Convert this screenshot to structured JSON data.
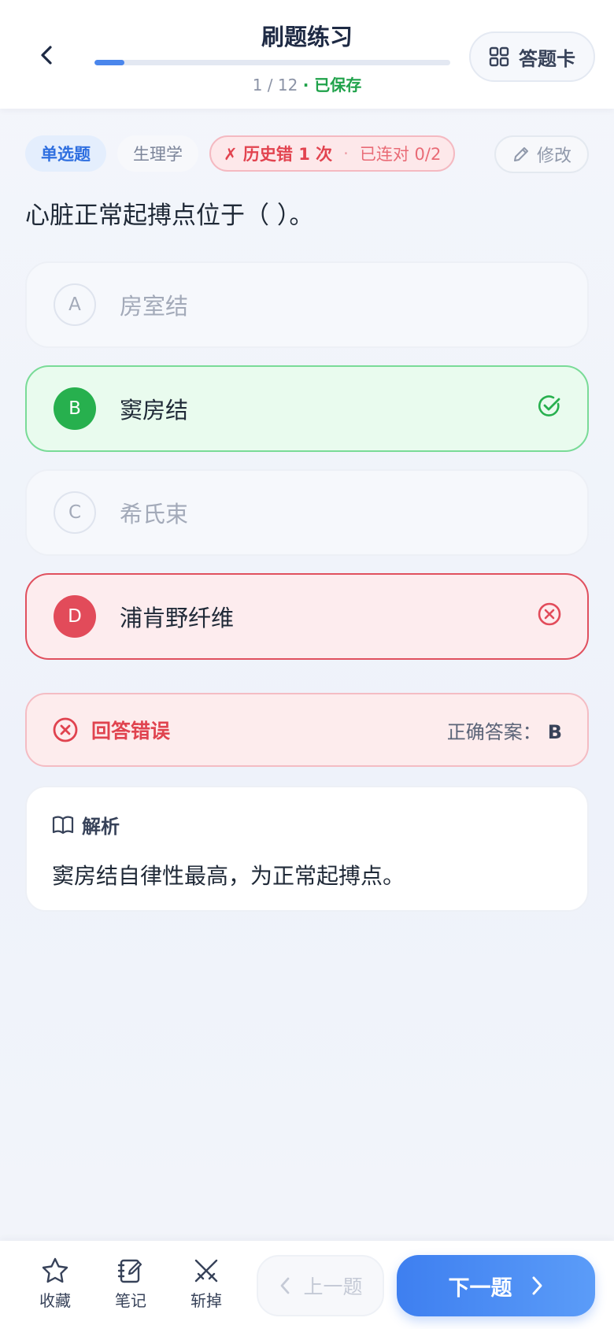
{
  "header": {
    "title": "刷题练习",
    "progress_current": 1,
    "progress_total": 12,
    "progress_text": "1 / 12",
    "saved_text": "· 已保存",
    "answer_card_label": "答题卡",
    "progress_fraction": 0.083
  },
  "tags": {
    "type": "单选题",
    "subject": "生理学",
    "history_error": "✗ 历史错 1 次",
    "history_separator": "·",
    "streak": "已连对 0/2"
  },
  "edit_label": "修改",
  "question": "心脏正常起搏点位于（ ）。",
  "options": [
    {
      "letter": "A",
      "text": "房室结",
      "state": "neutral"
    },
    {
      "letter": "B",
      "text": "窦房结",
      "state": "correct"
    },
    {
      "letter": "C",
      "text": "希氏束",
      "state": "neutral"
    },
    {
      "letter": "D",
      "text": "浦肯野纤维",
      "state": "wrong"
    }
  ],
  "result": {
    "label": "回答错误",
    "answer_prefix": "正确答案：",
    "answer_value": "B"
  },
  "analysis": {
    "title": "解析",
    "body": "窦房结自律性最高，为正常起搏点。"
  },
  "toolbar": {
    "favorite_label": "收藏",
    "note_label": "笔记",
    "remove_label": "斩掉",
    "prev_label": "上一题",
    "next_label": "下一题"
  },
  "colors": {
    "accent": "#3e7ff0",
    "correct": "#27b04e",
    "wrong": "#e24b5a"
  }
}
